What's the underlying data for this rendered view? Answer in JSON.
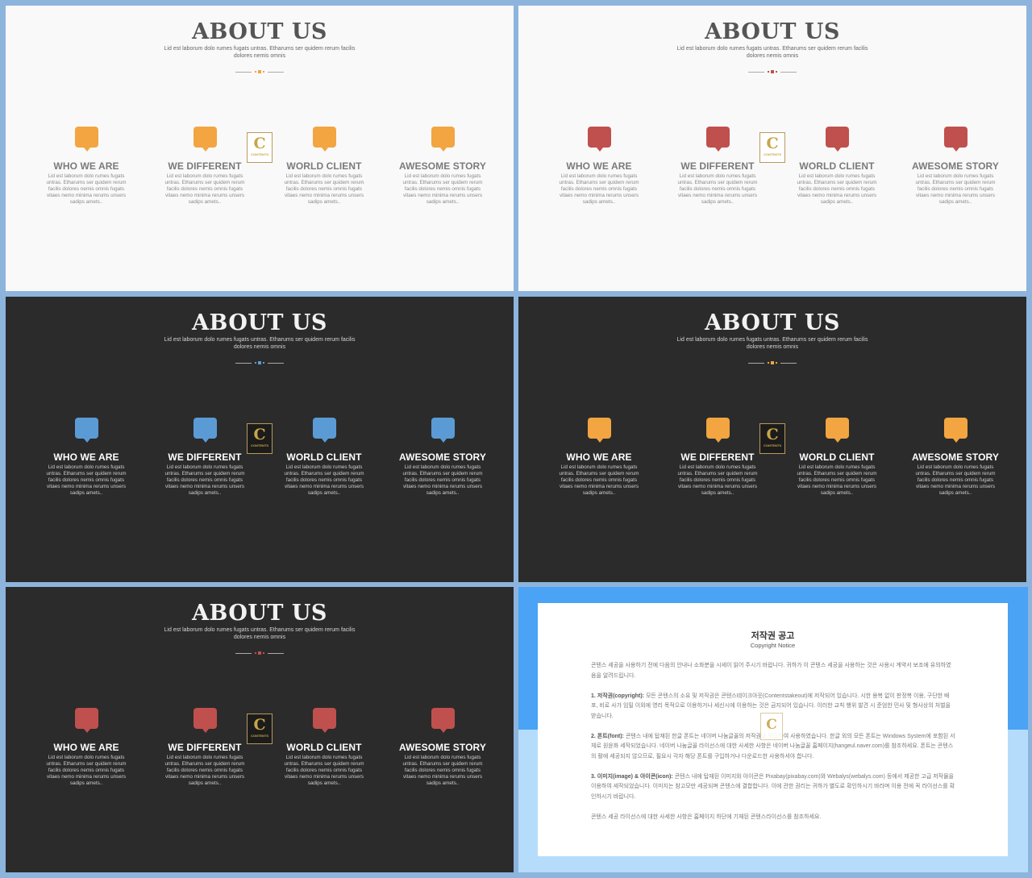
{
  "slide": {
    "title": "ABOUT US",
    "subtitle": "Lid est laborum dolo rumes fugats untras. Etharums ser quidem rerum facilis dolores nemis omnis",
    "items": [
      {
        "title": "WHO WE ARE",
        "text": "Lid est laborum dolo rumes fugats untras. Etharums ser quidem rerum facilis dolores nemis omnis fugats vitaes nemo minima rerums unsers sadips amets.."
      },
      {
        "title": "WE DIFFERENT",
        "text": "Lid est laborum dolo rumes fugats untras. Etharums ser quidem rerum facilis dolores nemis omnis fugats vitaes nemo minima rerums unsers sadips amets.."
      },
      {
        "title": "WORLD CLIENT",
        "text": "Lid est laborum dolo rumes fugats untras. Etharums ser quidem rerum facilis dolores nemis omnis fugats vitaes nemo minima rerums unsers sadips amets.."
      },
      {
        "title": "AWESOME STORY",
        "text": "Lid est laborum dolo rumes fugats untras. Etharums ser quidem rerum facilis dolores nemis omnis fugats vitaes nemo minima rerums unsers sadips amets.."
      }
    ],
    "logo": {
      "letter": "C",
      "word": "CONTENTS"
    }
  },
  "variants": [
    {
      "theme": "light",
      "accent": "#f2a541"
    },
    {
      "theme": "light",
      "accent": "#c0504d"
    },
    {
      "theme": "dark",
      "accent": "#5b9bd5"
    },
    {
      "theme": "dark",
      "accent": "#f2a541"
    },
    {
      "theme": "dark",
      "accent": "#c0504d"
    }
  ],
  "notice": {
    "title": "저작권 공고",
    "subtitle": "Copyright Notice",
    "paragraphs": [
      {
        "head": "",
        "text": "콘텐스 세공을 사용하기 전에 다음의 안내나 소화분을 시세이 읽어 주시기 바랍니다. 귀하가 이 콘텐스 세공을 사용하는 것은 사용시 계약서 보조에 유의하였음을 알려드립니다."
      },
      {
        "head": "1. 저작권(copyright):",
        "text": " 모든 콘텐스의 소유 및 저작권은 콘텐스테이크아웃(Contentstakeout)에 저작되어 있습니다. 시한 용복 없이 판정복 이용, 구단한 배포, 비로 사가 임밀 이외에 영리 목적으로 이용하거나 세신시에 이용하는 것은 금지되어 있습니다. 이러한 교칙 행위 발견 시 준엄한 민사 및 형사상의 처벌을 받습니다."
      },
      {
        "head": "2. 폰트(font):",
        "text": " 콘텐스 내에 탑재된 한글 폰트는 네이버 나눔글꼴의 저작권을 양도하여 사용하였습니다. 한글 외의 모든 폰트는 Windows System에 포함된 서체로 원윤화 세작되었습니다. 네이버 나눔글꼴 라이선스에 대한 사세한 사항은 네이버 나눔글꼴 홈페이지(hangeul.naver.com)를 참조하세요. 폰트는 콘텐스의 활에 세공되지 않으므로, 필요시 각자 해당 폰트를 구입하거나 다운로드한 사용하셔야 합니다."
      },
      {
        "head": "3. 이미지(image) & 아이콘(icon):",
        "text": " 콘텐스 내에 탑재된 이미지와 아이콘은 Pixabay(pixabay.com)와 Webalys(webalys.com) 등에서 제공한 고급 저작물을 이용하여 세작되었습니다. 이미지는 참고모만 세공되며 콘텐스에 결합합니다. 이에 관한 권리는 귀하가 별도로 확인하시기 바라며 이용 전에 꼭 라이선스를 확인하시기 바랍니다."
      },
      {
        "head": "",
        "text": "콘텐스 세공 라이선스에 대한 사세한 사항은 홈페이지 하단에 기재된 콘텐스라이선스를 참조하세요."
      }
    ]
  }
}
